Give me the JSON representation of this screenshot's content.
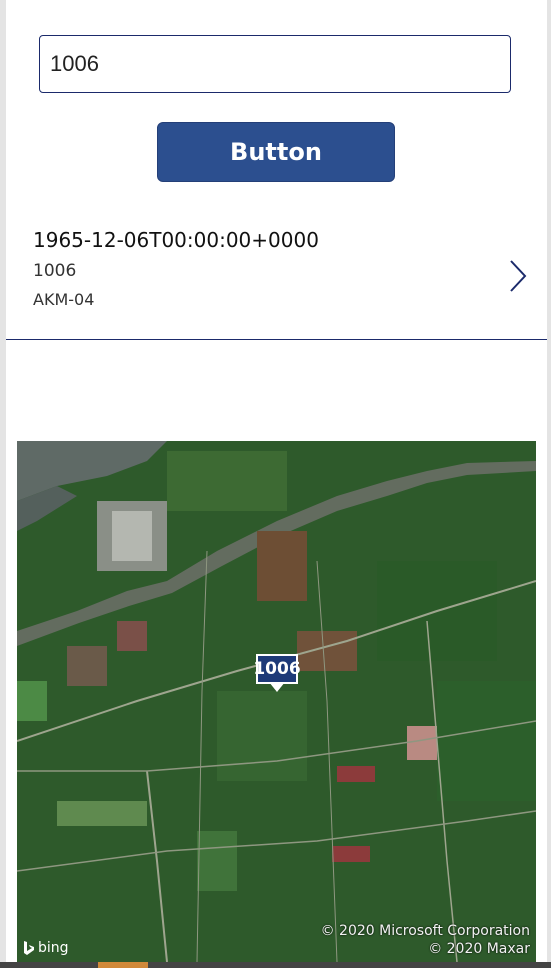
{
  "search": {
    "value": "1006"
  },
  "button": {
    "label": "Button"
  },
  "gallery": {
    "items": [
      {
        "title": "1965-12-06T00:00:00+0000",
        "subtitle": "1006",
        "body": "AKM-04"
      }
    ]
  },
  "map": {
    "pin_label": "1006",
    "provider": "bing",
    "copyright_line1": "© 2020 Microsoft Corporation",
    "copyright_line2": "© 2020 Maxar"
  }
}
